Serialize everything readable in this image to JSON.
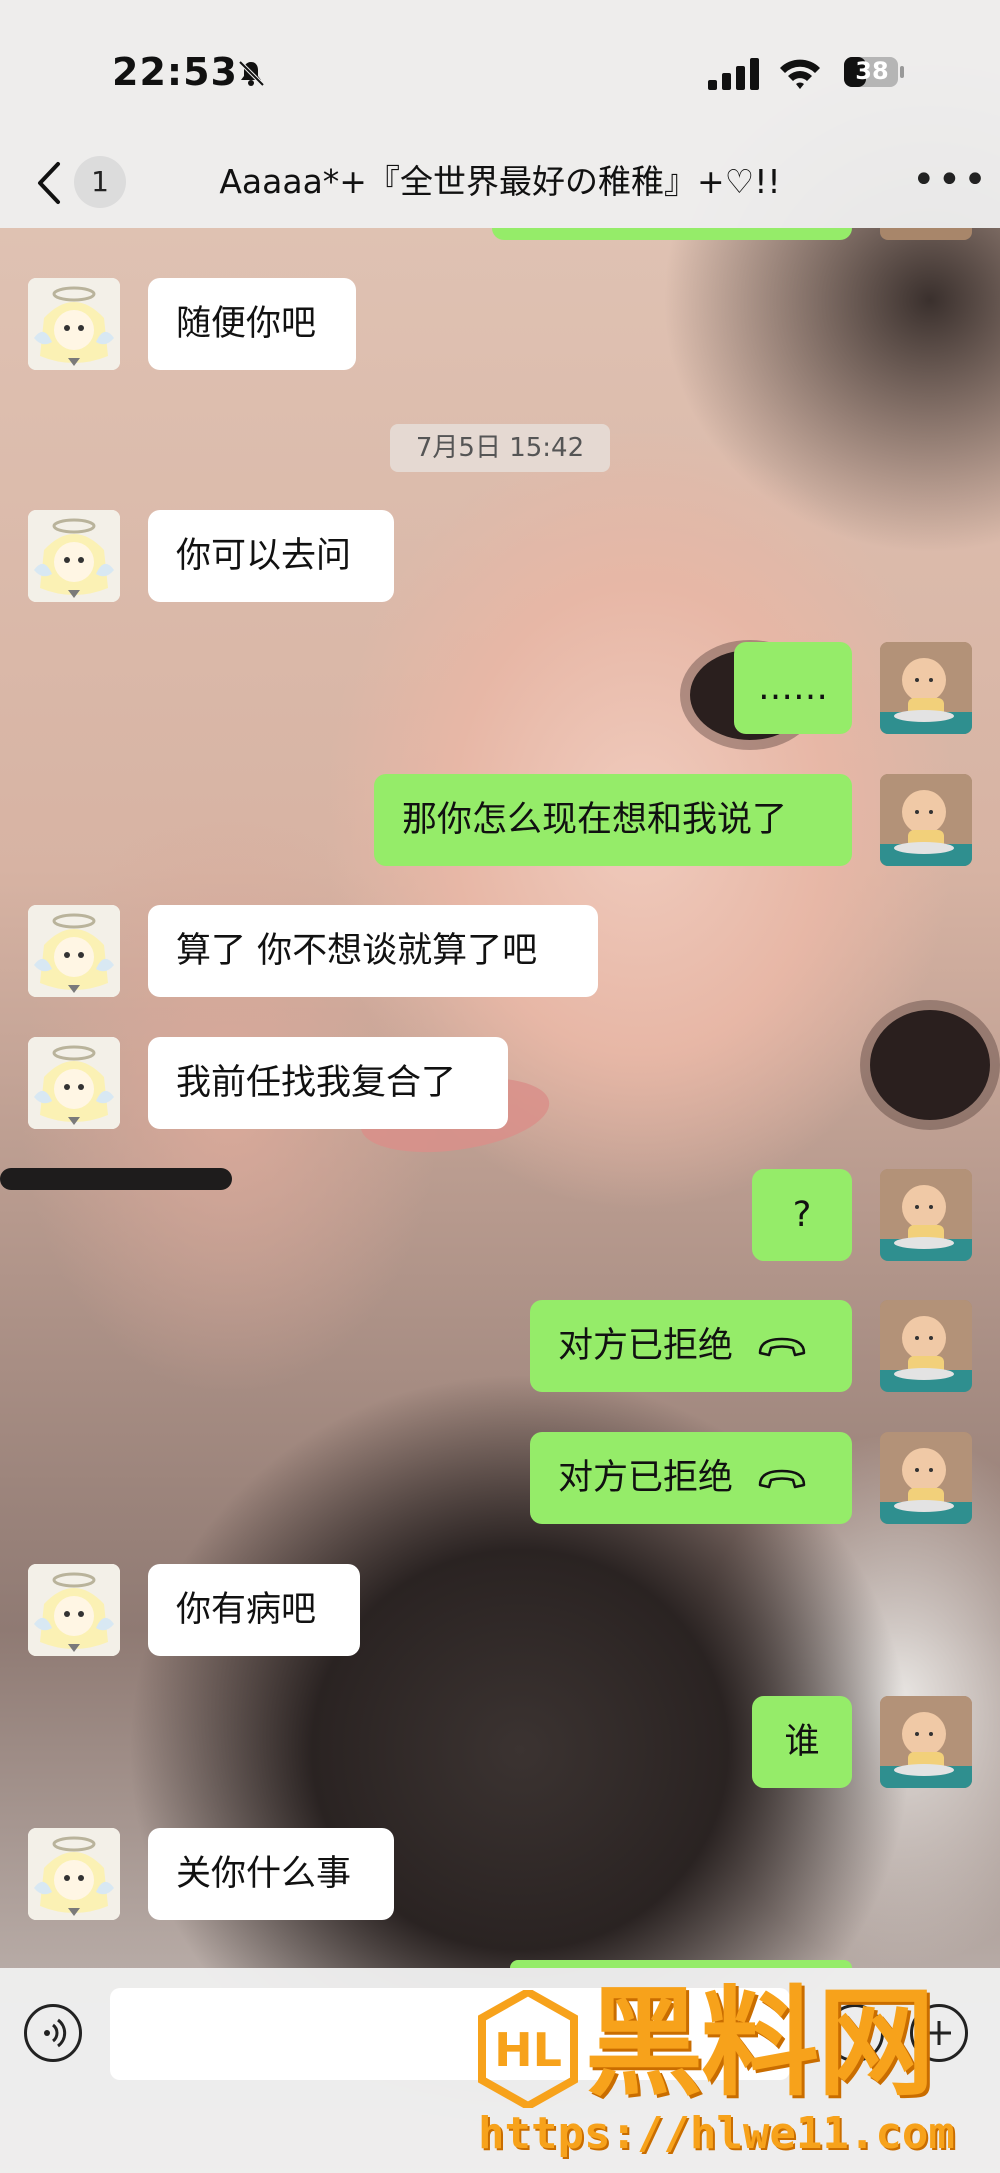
{
  "status_bar": {
    "time": "22:53",
    "battery": "38"
  },
  "nav": {
    "unread_count": "1",
    "title": "Aaaaa*+『全世界最好の稚稚』+♡!!"
  },
  "timestamp": "7月5日 15:42",
  "messages": [
    {
      "side": "left",
      "text": "随便你吧"
    },
    {
      "side": "left",
      "text": "你可以去问"
    },
    {
      "side": "right",
      "text": "……"
    },
    {
      "side": "right",
      "text": "那你怎么现在想和我说了"
    },
    {
      "side": "left",
      "text": "算了 你不想谈就算了吧"
    },
    {
      "side": "left",
      "text": "我前任找我复合了"
    },
    {
      "side": "right",
      "text": "?"
    },
    {
      "side": "right",
      "text": "对方已拒绝",
      "icon": "phone-hangup-icon"
    },
    {
      "side": "right",
      "text": "对方已拒绝",
      "icon": "phone-hangup-icon"
    },
    {
      "side": "left",
      "text": "你有病吧"
    },
    {
      "side": "right",
      "text": "谁"
    },
    {
      "side": "left",
      "text": "关你什么事"
    }
  ],
  "watermark": {
    "brand": "黑料网",
    "url": "https://hlwe11.com"
  },
  "colors": {
    "bubble_self": "#95ec69",
    "bubble_other": "#ffffff",
    "watermark": "#f7a21b"
  }
}
